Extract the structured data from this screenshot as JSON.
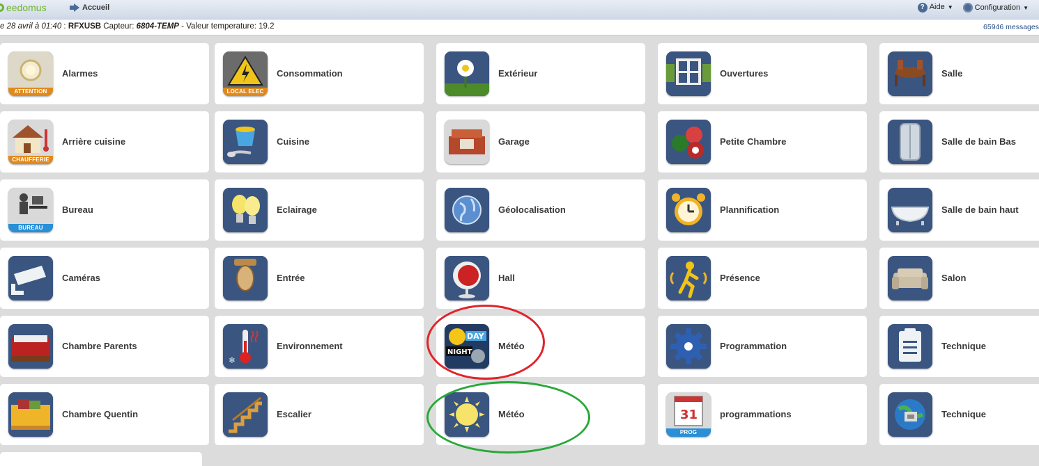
{
  "header": {
    "logo": "eedomus",
    "home_label": "Accueil",
    "help_label": "Aide",
    "config_label": "Configuration"
  },
  "message": {
    "date": "e 28 avril à 01:40",
    "sep": " : ",
    "source": "RFXUSB",
    "capteur_label": " Capteur: ",
    "sensor": "6804-TEMP",
    "value_text": " - Valeur temperature: 19.2",
    "count": "65946 messages"
  },
  "icons": {
    "alarmes": "alarm-icon",
    "consommation": "power-consumption-icon",
    "exterieur": "outdoor-flower-icon",
    "ouvertures": "window-icon",
    "salle": "dining-room-icon",
    "arriere": "house-boiler-icon",
    "cuisine": "kitchen-icon",
    "garage": "garage-icon",
    "petite": "billiard-balls-icon",
    "sdb-bas": "shower-icon",
    "bureau": "office-desk-icon",
    "eclairage": "light-bulbs-icon",
    "geoloc": "globe-icon",
    "planif": "alarm-clock-icon",
    "sdb-haut": "bathtub-icon",
    "cameras": "camera-icon",
    "entree": "door-handle-icon",
    "hall": "egg-chair-icon",
    "presence": "motion-detector-icon",
    "salon": "sofa-icon",
    "chambre-p": "bed-icon",
    "environnement": "thermometer-icon",
    "meteo1": "day-night-weather-icon",
    "programmation": "gear-icon",
    "technique1": "clipboard-icon",
    "chambre-q": "bed-icon",
    "escalier": "staircase-icon",
    "meteo2": "sun-icon",
    "programmations": "calendar-prog-icon",
    "technique2": "network-globe-icon"
  },
  "tiles": {
    "alarmes": {
      "label": "Alarmes",
      "ribbon": "ATTENTION"
    },
    "consommation": {
      "label": "Consommation",
      "ribbon": "LOCAL ELEC"
    },
    "exterieur": {
      "label": "Extérieur"
    },
    "ouvertures": {
      "label": "Ouvertures"
    },
    "salle": {
      "label": "Salle"
    },
    "arriere": {
      "label": "Arrière cuisine",
      "ribbon": "CHAUFFERIE"
    },
    "cuisine": {
      "label": "Cuisine"
    },
    "garage": {
      "label": "Garage"
    },
    "petite": {
      "label": "Petite Chambre"
    },
    "sdb-bas": {
      "label": "Salle de bain Bas"
    },
    "bureau": {
      "label": "Bureau",
      "ribbon": "BUREAU"
    },
    "eclairage": {
      "label": "Eclairage"
    },
    "geoloc": {
      "label": "Géolocalisation"
    },
    "planif": {
      "label": "Plannification"
    },
    "sdb-haut": {
      "label": "Salle de bain haut"
    },
    "cameras": {
      "label": "Caméras"
    },
    "entree": {
      "label": "Entrée"
    },
    "hall": {
      "label": "Hall"
    },
    "presence": {
      "label": "Présence"
    },
    "salon": {
      "label": "Salon"
    },
    "chambre-p": {
      "label": "Chambre Parents"
    },
    "environnement": {
      "label": "Environnement"
    },
    "meteo1": {
      "label": "Météo",
      "badge_day": "DAY",
      "badge_night": "NIGHT"
    },
    "programmation": {
      "label": "Programmation"
    },
    "technique1": {
      "label": "Technique"
    },
    "chambre-q": {
      "label": "Chambre Quentin"
    },
    "escalier": {
      "label": "Escalier"
    },
    "meteo2": {
      "label": "Météo"
    },
    "programmations": {
      "label": "programmations",
      "ribbon": "PROG"
    },
    "technique2": {
      "label": "Technique"
    }
  },
  "annotations": {
    "red_circle_color": "#e0242b",
    "green_circle_color": "#2aa83a"
  }
}
